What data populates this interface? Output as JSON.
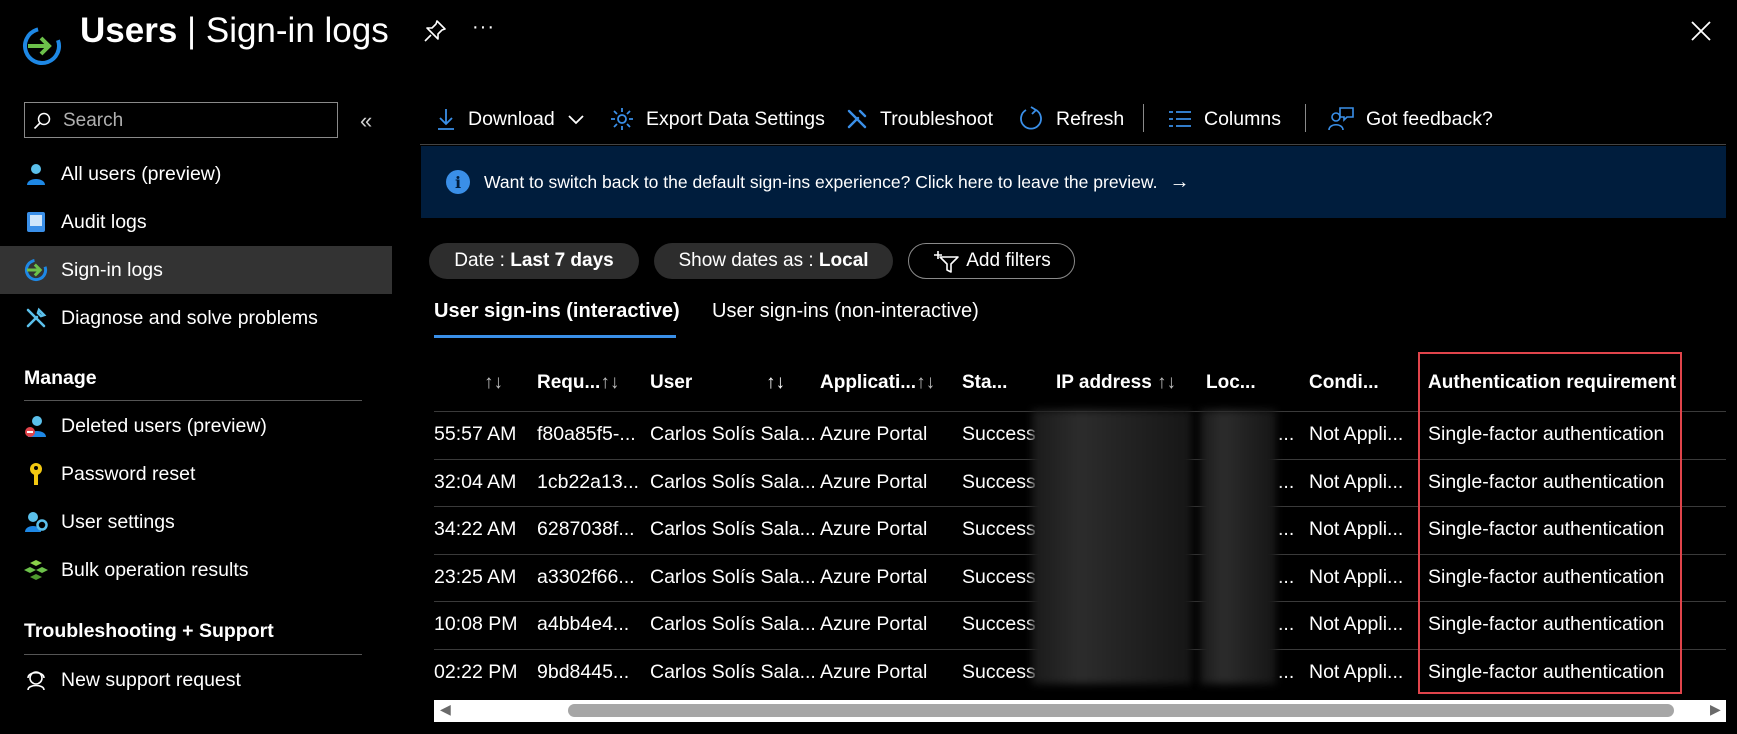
{
  "header": {
    "title_bold": "Users",
    "title_sep": " | ",
    "title_rest": "Sign-in logs",
    "more": "···"
  },
  "sidebar": {
    "search_placeholder": "Search",
    "collapse": "«",
    "items": [
      {
        "label": "All users (preview)",
        "icon": "user-icon"
      },
      {
        "label": "Audit logs",
        "icon": "audit-log-icon"
      },
      {
        "label": "Sign-in logs",
        "icon": "sign-in-icon",
        "active": true
      },
      {
        "label": "Diagnose and solve problems",
        "icon": "wrench-icon"
      }
    ],
    "manage_heading": "Manage",
    "manage_items": [
      {
        "label": "Deleted users (preview)",
        "icon": "deleted-user-icon"
      },
      {
        "label": "Password reset",
        "icon": "key-icon"
      },
      {
        "label": "User settings",
        "icon": "user-settings-icon"
      },
      {
        "label": "Bulk operation results",
        "icon": "bulk-operation-icon"
      }
    ],
    "support_heading": "Troubleshooting + Support",
    "support_items": [
      {
        "label": "New support request",
        "icon": "support-icon"
      }
    ]
  },
  "toolbar": {
    "download": "Download",
    "export": "Export Data Settings",
    "troubleshoot": "Troubleshoot",
    "refresh": "Refresh",
    "columns": "Columns",
    "feedback": "Got feedback?"
  },
  "banner": {
    "text": "Want to switch back to the default sign-ins experience? Click here to leave the preview.",
    "arrow": "→"
  },
  "filters": {
    "date_label": "Date : ",
    "date_value": "Last 7 days",
    "show_label": "Show dates as : ",
    "show_value": "Local",
    "add": "Add filters"
  },
  "tabs": {
    "interactive": "User sign-ins (interactive)",
    "noninteractive": "User sign-ins (non-interactive)"
  },
  "table": {
    "headers": {
      "date": "",
      "request": "Requ...",
      "user": "User",
      "application": "Applicati...",
      "status": "Sta...",
      "ip": "IP address",
      "location": "Loc...",
      "conditional": "Condi...",
      "auth": "Authentication requirement"
    },
    "sort_glyph": "↑↓",
    "rows": [
      {
        "date": "55:57 AM",
        "request": "f80a85f5-...",
        "user": "Carlos Solís Sala...",
        "application": "Azure Portal",
        "status": "Success",
        "location": "...",
        "conditional": "Not Appli...",
        "auth": "Single-factor authentication"
      },
      {
        "date": "32:04 AM",
        "request": "1cb22a13...",
        "user": "Carlos Solís Sala...",
        "application": "Azure Portal",
        "status": "Success",
        "location": "...",
        "conditional": "Not Appli...",
        "auth": "Single-factor authentication"
      },
      {
        "date": "34:22 AM",
        "request": "6287038f...",
        "user": "Carlos Solís Sala...",
        "application": "Azure Portal",
        "status": "Success",
        "location": "...",
        "conditional": "Not Appli...",
        "auth": "Single-factor authentication"
      },
      {
        "date": "23:25 AM",
        "request": "a3302f66...",
        "user": "Carlos Solís Sala...",
        "application": "Azure Portal",
        "status": "Success",
        "location": "...",
        "conditional": "Not Appli...",
        "auth": "Single-factor authentication"
      },
      {
        "date": "10:08 PM",
        "request": "a4bb4e4...",
        "user": "Carlos Solís Sala...",
        "application": "Azure Portal",
        "status": "Success",
        "location": "...",
        "conditional": "Not Appli...",
        "auth": "Single-factor authentication"
      },
      {
        "date": "02:22 PM",
        "request": "9bd8445...",
        "user": "Carlos Solís Sala...",
        "application": "Azure Portal",
        "status": "Success",
        "location": "...",
        "conditional": "Not Appli...",
        "auth": "Single-factor authentication"
      }
    ]
  },
  "scrollbar": {
    "left_arrow": "◀",
    "right_arrow": "▶"
  },
  "colors": {
    "accent": "#3a8fe8",
    "highlight": "#e0444b",
    "banner": "#001d3d"
  }
}
